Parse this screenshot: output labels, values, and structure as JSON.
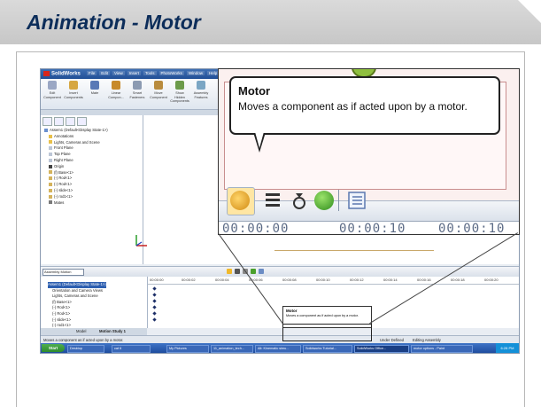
{
  "slide": {
    "title": "Animation - Motor"
  },
  "solidworks": {
    "app_name": "SolidWorks",
    "menu": [
      "File",
      "Edit",
      "View",
      "Insert",
      "Tools",
      "PhotoWorks",
      "Window",
      "Help"
    ],
    "toolbar": [
      {
        "label": "Edit Component",
        "icon": "edit-component-icon",
        "color": "#9aa7c4"
      },
      {
        "label": "Insert Components",
        "icon": "insert-components-icon",
        "color": "#d6a742"
      },
      {
        "label": "Mate",
        "icon": "mate-icon",
        "color": "#5a79b6"
      },
      {
        "label": "Linear Compon...",
        "icon": "linear-pattern-icon",
        "color": "#c78a2b"
      },
      {
        "label": "Smart Fasteners",
        "icon": "smart-fasteners-icon",
        "color": "#8c9bb2"
      },
      {
        "label": "Move Component",
        "icon": "move-component-icon",
        "color": "#b98c3e"
      },
      {
        "label": "Show Hidden Components",
        "icon": "show-hidden-icon",
        "color": "#6c9b4a"
      },
      {
        "label": "Assembly Features",
        "icon": "assembly-features-icon",
        "color": "#7aa6c4"
      }
    ],
    "feature_tree": [
      "Assem1 (Default<Display State-1>)",
      "Annotations",
      "Lights, Cameras and Scene",
      "Front Plane",
      "Top Plane",
      "Right Plane",
      "Origin",
      "(f) Base<1>",
      "(-) Rod<1>",
      "(-) Rod<1>",
      "(-) slide<1>",
      "(-) rod1<1>",
      "Mates"
    ],
    "motion_study_type": "Assembly Motion",
    "motion_tree": [
      "Assem1 (Default<Display State-1>)",
      "Orientation and Camera Views",
      "Lights, Cameras and Scene",
      "(f) Base<1>",
      "(-) Rod<1>",
      "(-) Rod<1>",
      "(-) slide<1>",
      "(-) rod1<1>"
    ],
    "timeline_ticks": [
      "00:00:00",
      "00:00:02",
      "00:00:04",
      "00:00:06",
      "00:00:08",
      "00:00:10",
      "00:00:12",
      "00:00:14",
      "00:00:16",
      "00:00:18",
      "00:00:20"
    ],
    "bottom_tabs": [
      "Model",
      "Motion Study 1"
    ],
    "status_left": "Moves a component as if acted upon by a motor.",
    "status_right": [
      "Under Defined",
      "Editing Assembly"
    ],
    "taskbar": {
      "start": "Start",
      "tasks": [
        "Desktop",
        "cat 6",
        "My Pictures",
        "11_animation_tech...",
        "Alt: Kinematic simu...",
        "Solidworks Tutorial...",
        "SolidWorks Office...",
        "motor options - Paint"
      ],
      "clock": "6:28 PM"
    },
    "small_tooltip": {
      "title": "Motor",
      "text": "Moves a component as if acted upon by a motor."
    }
  },
  "zoom": {
    "tooltip_title": "Motor",
    "tooltip_text": "Moves a component as if acted upon by a motor.",
    "numbers": [
      "00:00:00",
      "00:00:10",
      "00:00:10"
    ],
    "icons": [
      "motor-icon",
      "spring-icon",
      "gravity-icon",
      "results-icon",
      "properties-icon"
    ]
  }
}
